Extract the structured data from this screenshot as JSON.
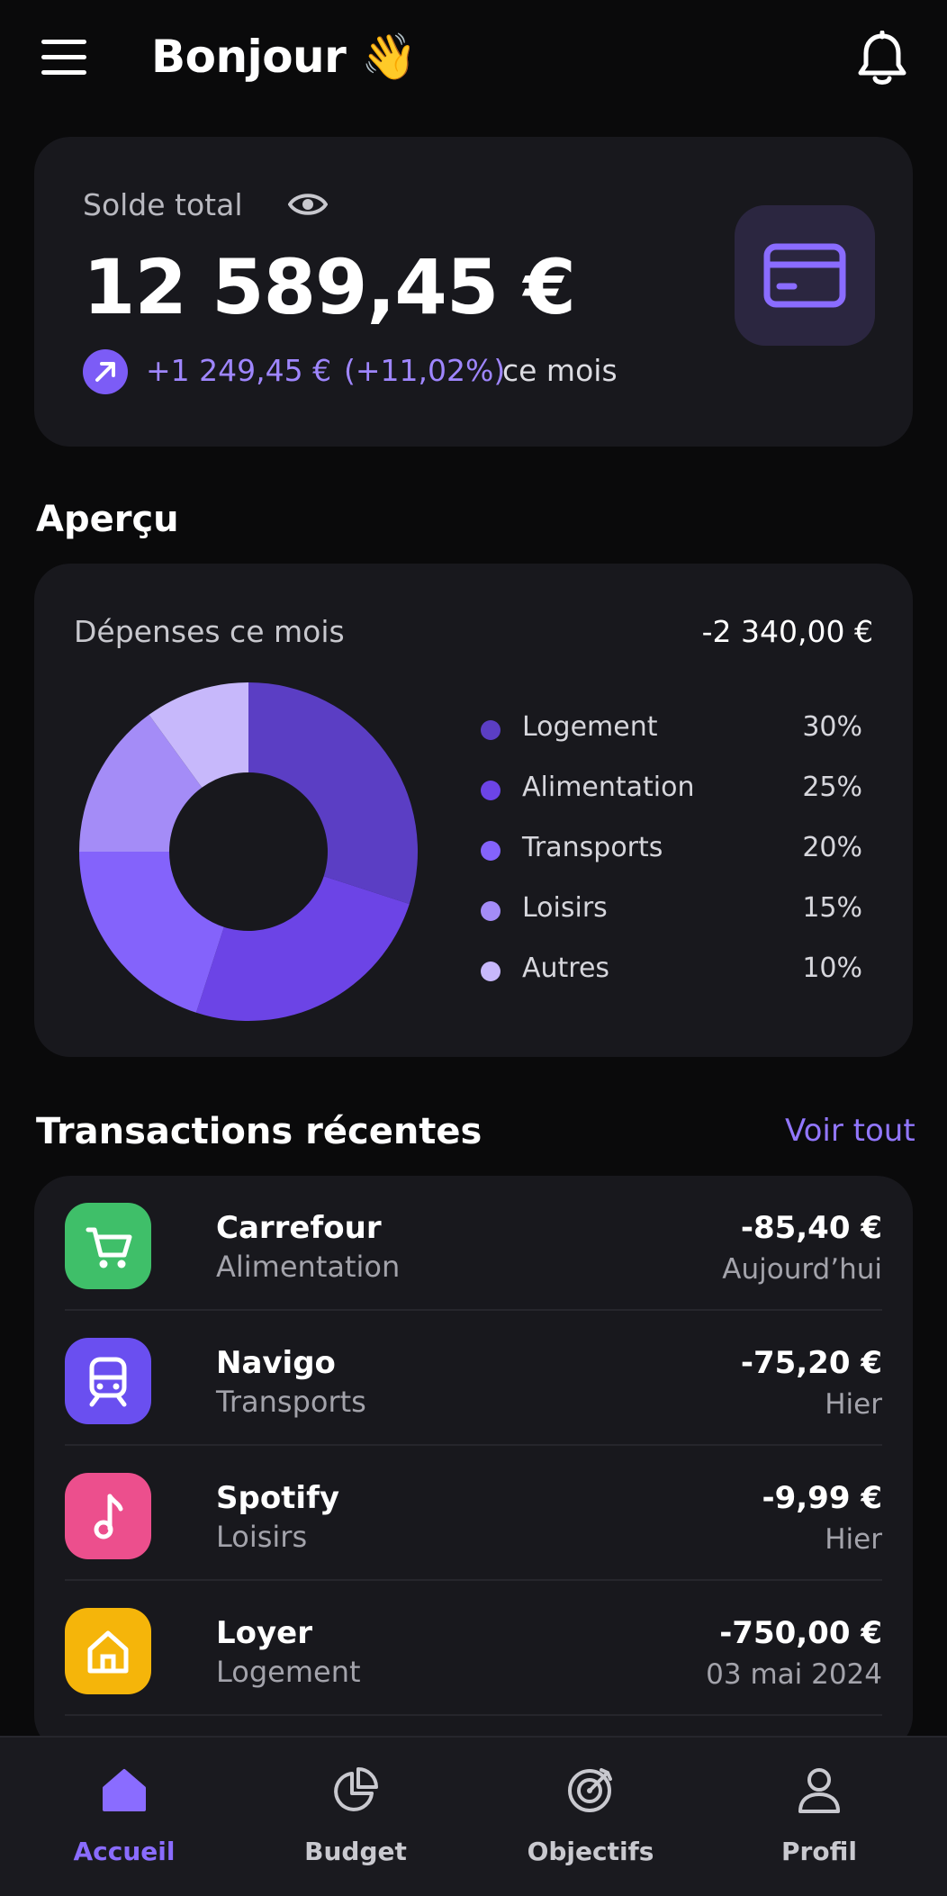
{
  "header": {
    "title": "Bonjour 👋"
  },
  "balance": {
    "label": "Solde total",
    "amount": "12 589,45 €",
    "change_value": "+1 249,45 €",
    "change_pct": "(+11,02%)",
    "change_suffix": "ce mois"
  },
  "overview": {
    "section_title": "Aperçu",
    "label": "Dépenses ce mois",
    "total": "-2 340,00 €"
  },
  "chart_data": {
    "type": "pie",
    "donut": true,
    "categories": [
      "Logement",
      "Alimentation",
      "Transports",
      "Loisirs",
      "Autres"
    ],
    "values": [
      30,
      25,
      20,
      15,
      10
    ],
    "labels": [
      "30%",
      "25%",
      "20%",
      "15%",
      "10%"
    ],
    "colors": [
      "#5b3ec4",
      "#6c44e6",
      "#8463fb",
      "#a48cf7",
      "#c7b8fb"
    ],
    "legend_position": "right"
  },
  "transactions": {
    "section_title": "Transactions récentes",
    "see_all": "Voir tout",
    "items": [
      {
        "name": "Carrefour",
        "category": "Alimentation",
        "amount": "-85,40 €",
        "date": "Aujourd’hui",
        "icon": "cart-icon",
        "color": "#3fbf69"
      },
      {
        "name": "Navigo",
        "category": "Transports",
        "amount": "-75,20 €",
        "date": "Hier",
        "icon": "train-icon",
        "color": "#6a4ff0"
      },
      {
        "name": "Spotify",
        "category": "Loisirs",
        "amount": "-9,99 €",
        "date": "Hier",
        "icon": "music-note-icon",
        "color": "#ec4f8d"
      },
      {
        "name": "Loyer",
        "category": "Logement",
        "amount": "-750,00 €",
        "date": "03 mai 2024",
        "icon": "home-icon",
        "color": "#f5b50a"
      }
    ]
  },
  "nav": {
    "items": [
      {
        "label": "Accueil",
        "icon": "home-icon",
        "active": true
      },
      {
        "label": "Budget",
        "icon": "pie-chart-icon",
        "active": false
      },
      {
        "label": "Objectifs",
        "icon": "target-icon",
        "active": false
      },
      {
        "label": "Profil",
        "icon": "user-icon",
        "active": false
      }
    ]
  },
  "colors": {
    "accent": "#8a6cff",
    "background": "#0a0a0b",
    "card": "#18181d"
  }
}
